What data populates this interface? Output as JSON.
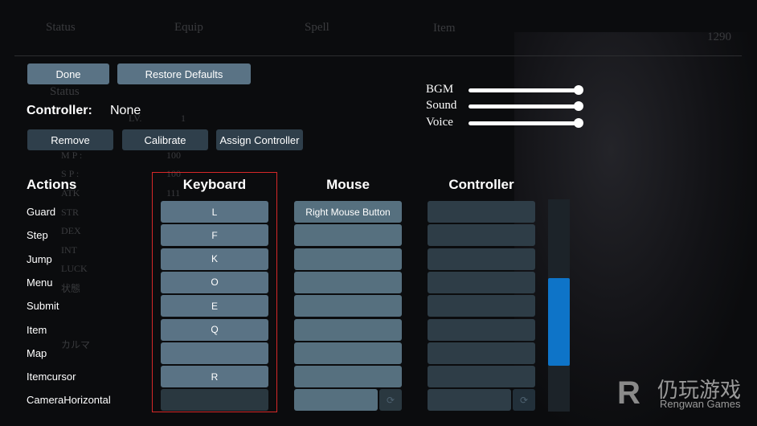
{
  "background": {
    "tabs": [
      "Status",
      "Equip",
      "Spell",
      "Item"
    ],
    "gold": "1290",
    "panel_title": "Status",
    "stats": [
      "LV.",
      "1",
      "M P :",
      "100",
      "S P :",
      "100",
      "ATK",
      "111",
      "STR",
      "DEX",
      "INT",
      "LUCK",
      "状態",
      "カルマ"
    ]
  },
  "top_buttons": {
    "done": "Done",
    "restore": "Restore Defaults"
  },
  "controller": {
    "label": "Controller:",
    "value": "None",
    "remove": "Remove",
    "calibrate": "Calibrate",
    "assign": "Assign Controller"
  },
  "audio": [
    {
      "label": "BGM",
      "value": 1.0
    },
    {
      "label": "Sound",
      "value": 1.0
    },
    {
      "label": "Voice",
      "value": 1.0
    }
  ],
  "columns": {
    "actions": "Actions",
    "keyboard": "Keyboard",
    "mouse": "Mouse",
    "controller": "Controller"
  },
  "rows": [
    {
      "action": "Guard",
      "keyboard": "L",
      "mouse": "Right Mouse Button",
      "controller": ""
    },
    {
      "action": "Step",
      "keyboard": "F",
      "mouse": "",
      "controller": ""
    },
    {
      "action": "Jump",
      "keyboard": "K",
      "mouse": "",
      "controller": ""
    },
    {
      "action": "Menu",
      "keyboard": "O",
      "mouse": "",
      "controller": ""
    },
    {
      "action": "Submit",
      "keyboard": "E",
      "mouse": "",
      "controller": ""
    },
    {
      "action": "Item",
      "keyboard": "Q",
      "mouse": "",
      "controller": ""
    },
    {
      "action": "Map",
      "keyboard": "",
      "mouse": "",
      "controller": ""
    },
    {
      "action": "Itemcursor",
      "keyboard": "R",
      "mouse": "",
      "controller": ""
    },
    {
      "action": "CameraHorizontal",
      "keyboard": "",
      "mouse": "",
      "controller": ""
    }
  ],
  "scrollbar": {
    "position_fraction": 0.37,
    "accent": "#0e74c8"
  },
  "highlight_color": "#d62828",
  "watermark": {
    "cn": "仍玩游戏",
    "en": "Rengwan Games"
  }
}
